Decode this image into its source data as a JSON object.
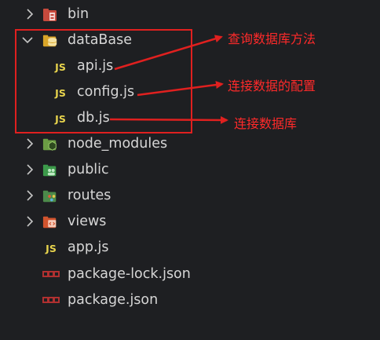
{
  "tree": {
    "bin": "bin",
    "database_folder": "dataBase",
    "api": "api.js",
    "config": "config.js",
    "db": "db.js",
    "node_modules": "node_modules",
    "public": "public",
    "routes": "routes",
    "views": "views",
    "app": "app.js",
    "package_lock": "package-lock.json",
    "package": "package.json",
    "js_badge": "JS"
  },
  "annotations": {
    "api_note": "查询数据库方法",
    "config_note": "连接数据的配置",
    "db_note": "连接数据库"
  },
  "colors": {
    "background": "#1e1f22",
    "annotation_red": "#e0201f",
    "js_yellow": "#e8d44d"
  }
}
